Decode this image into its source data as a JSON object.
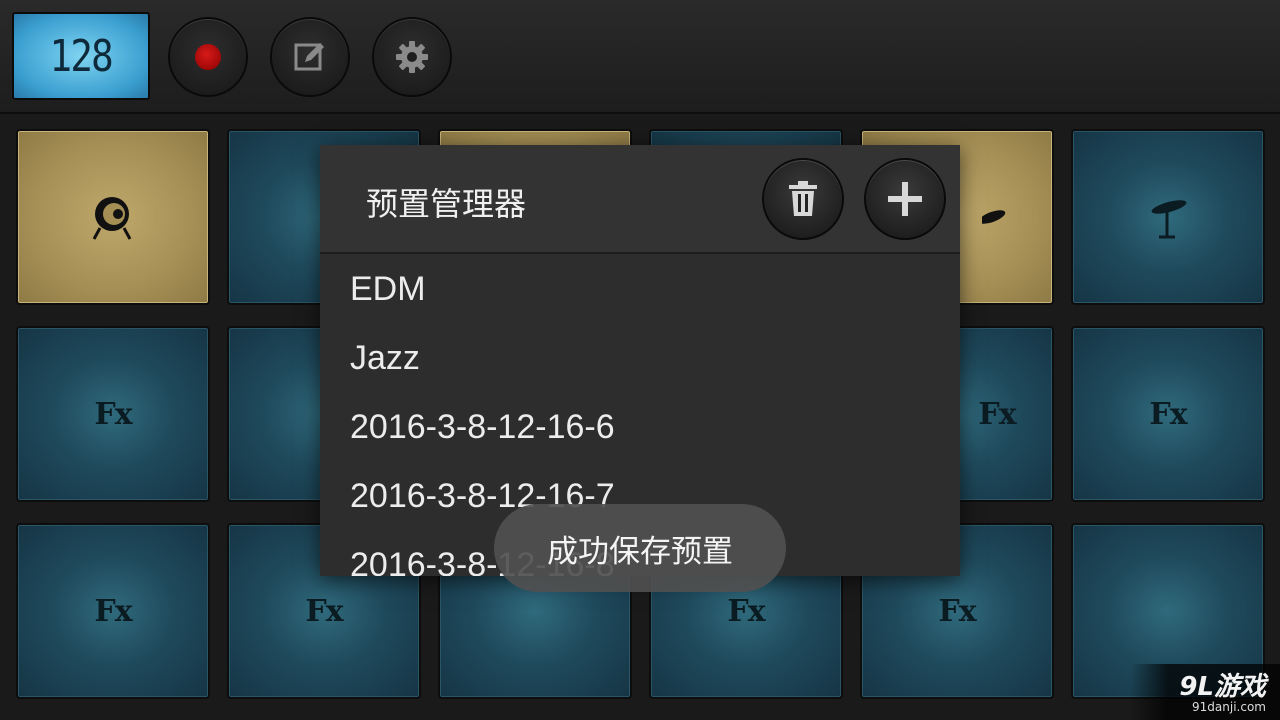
{
  "toolbar": {
    "bpm": "128",
    "icons": [
      "record-icon",
      "edit-icon",
      "settings-gear-icon"
    ]
  },
  "pads": {
    "fx_label": "Fx",
    "colors": {
      "blue": "#1f4a5c",
      "gold": "#a58f55"
    }
  },
  "dialog": {
    "title": "预置管理器",
    "delete_icon": "trash-icon",
    "add_icon": "plus-icon",
    "presets": [
      "EDM",
      "Jazz",
      "2016-3-8-12-16-6",
      "2016-3-8-12-16-7",
      "2016-3-8-12-16-8"
    ]
  },
  "toast": {
    "message": "成功保存预置"
  },
  "watermark": {
    "brand": "9L游戏",
    "url": "91danji.com"
  }
}
